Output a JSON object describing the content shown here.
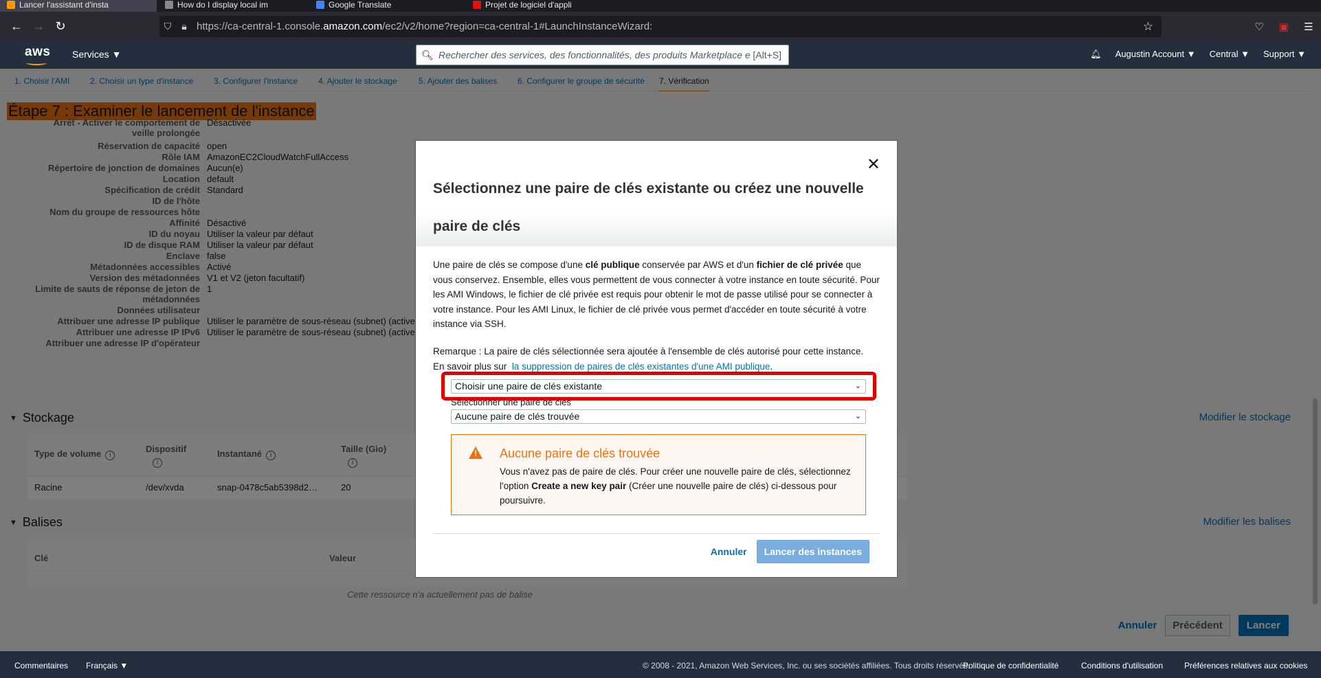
{
  "browser": {
    "tabs": [
      "Lancer l'assistant d'insta",
      "How do I display local im",
      "Google Translate",
      "Projet de logiciel d'appli"
    ],
    "url_prefix": "https://ca-central-1.console.",
    "url_domain": "amazon.com",
    "url_suffix": "/ec2/v2/home?region=ca-central-1#LaunchInstanceWizard:"
  },
  "aws": {
    "logo": "aws",
    "services": "Services ▼",
    "search_placeholder": "Rechercher des services, des fonctionnalités, des produits Marketplace e",
    "search_shortcut": "[Alt+S]",
    "account": "Augustin Account ▼",
    "region": "Central ▼",
    "support": "Support ▼"
  },
  "steps": [
    "1. Choisir l'AMI",
    "2. Choisir un type d'instance",
    "3. Configurer l'instance",
    "4. Ajouter le stockage",
    "5. Ajouter des balises",
    "6. Configurer le groupe de sécurité",
    "7. Vérification"
  ],
  "page_title": "Étape 7 : Examiner le lancement de l'instance",
  "details": [
    {
      "k": "Arrêt - Activer le comportement de",
      "v": "Désactivée"
    },
    {
      "k": "veille prolongée",
      "v": ""
    },
    {
      "k": "Réservation de capacité",
      "v": "open"
    },
    {
      "k": "Rôle IAM",
      "v": "AmazonEC2CloudWatchFullAccess"
    },
    {
      "k": "Répertoire de jonction de domaines",
      "v": "Aucun(e)"
    },
    {
      "k": "Location",
      "v": "default"
    },
    {
      "k": "Spécification de crédit",
      "v": "Standard"
    },
    {
      "k": "ID de l'hôte",
      "v": ""
    },
    {
      "k": "Nom du groupe de ressources hôte",
      "v": ""
    },
    {
      "k": "Affinité",
      "v": "Désactivé"
    },
    {
      "k": "ID du noyau",
      "v": "Utiliser la valeur par défaut"
    },
    {
      "k": "ID de disque RAM",
      "v": "Utiliser la valeur par défaut"
    },
    {
      "k": "Enclave",
      "v": "false"
    },
    {
      "k": "Métadonnées accessibles",
      "v": "Activé"
    },
    {
      "k": "Version des métadonnées",
      "v": "V1 et V2 (jeton facultatif)"
    },
    {
      "k": "Limite de sauts de réponse de jeton de",
      "v": "1"
    },
    {
      "k": "métadonnées",
      "v": ""
    },
    {
      "k": "Données utilisateur",
      "v": ""
    },
    {
      "k": "Attribuer une adresse IP publique",
      "v": "Utiliser le paramètre de sous-réseau (subnet) (active"
    },
    {
      "k": "Attribuer une adresse IP IPv6",
      "v": "Utiliser le paramètre de sous-réseau (subnet) (active"
    },
    {
      "k": "Attribuer une adresse IP d'opérateur",
      "v": ""
    }
  ],
  "storage": {
    "title": "Stockage",
    "edit": "Modifier le stockage",
    "headers": [
      "Type de volume",
      "Dispositif",
      "Instantané",
      "Taille (Gio)"
    ],
    "row": [
      "Racine",
      "/dev/xvda",
      "snap-0478c5ab5398d2…",
      "20"
    ]
  },
  "tags": {
    "title": "Balises",
    "edit": "Modifier les balises",
    "headers": [
      "Clé",
      "Valeur"
    ],
    "empty": "Cette ressource n'a actuellement pas de balise"
  },
  "bottom_actions": {
    "cancel": "Annuler",
    "previous": "Précédent",
    "launch": "Lancer"
  },
  "modal": {
    "title": "Sélectionnez une paire de clés existante ou créez une nouvelle paire de clés",
    "body_1": "Une paire de clés se compose d'une ",
    "body_b1": "clé publique",
    "body_2": " conservée par AWS et d'un ",
    "body_b2": "fichier de clé privée",
    "body_3": " que vous conservez. Ensemble, elles vous permettent de vous connecter à votre instance en toute sécurité. Pour les AMI Windows, le fichier de clé privée est requis pour obtenir le mot de passe utilisé pour se connecter à votre instance. Pour les AMI Linux, le fichier de clé privée vous permet d'accéder en toute sécurité à votre instance via SSH.",
    "remark": "Remarque : La paire de clés sélectionnée sera ajoutée à l'ensemble de clés autorisé pour cette instance.",
    "learn_more": "En savoir plus sur",
    "learn_link": "la suppression de paires de clés existantes d'une AMI publique",
    "select_1": "Choisir une paire de clés existante",
    "select_label": "Sélectionner une paire de clés",
    "select_2": "Aucune paire de clés trouvée",
    "alert_title": "Aucune paire de clés trouvée",
    "alert_body_1": "Vous n'avez pas de paire de clés. Pour créer une nouvelle paire de clés, sélectionnez l'option ",
    "alert_body_b": "Create a new key pair",
    "alert_body_2": " (Créer une nouvelle paire de clés) ci-dessous pour poursuivre.",
    "cancel": "Annuler",
    "launch": "Lancer des instances"
  },
  "footer": {
    "feedback": "Commentaires",
    "language": "Français ▼",
    "copyright": "© 2008 - 2021, Amazon Web Services, Inc. ou ses sociétés affiliées. Tous droits réservés.",
    "privacy": "Politique de confidentialité",
    "terms": "Conditions d'utilisation",
    "cookies": "Préférences relatives aux cookies"
  }
}
